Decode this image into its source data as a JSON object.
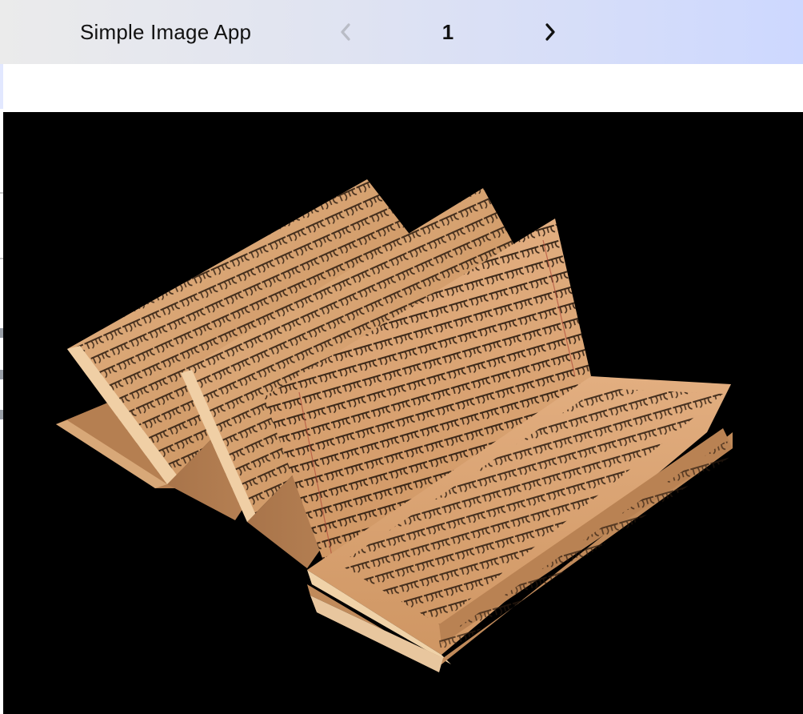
{
  "app": {
    "title": "Simple Image App"
  },
  "pager": {
    "current_page": "1",
    "prev_icon": "chevron-left-icon",
    "next_icon": "chevron-right-icon"
  },
  "colors": {
    "topbar_start": "#ebebeb",
    "topbar_end": "#cdd8ff",
    "photo_background": "#000000",
    "paper": "#d9a574",
    "ink": "#1f140c"
  },
  "image": {
    "subject": "folded palm-leaf style manuscript"
  }
}
